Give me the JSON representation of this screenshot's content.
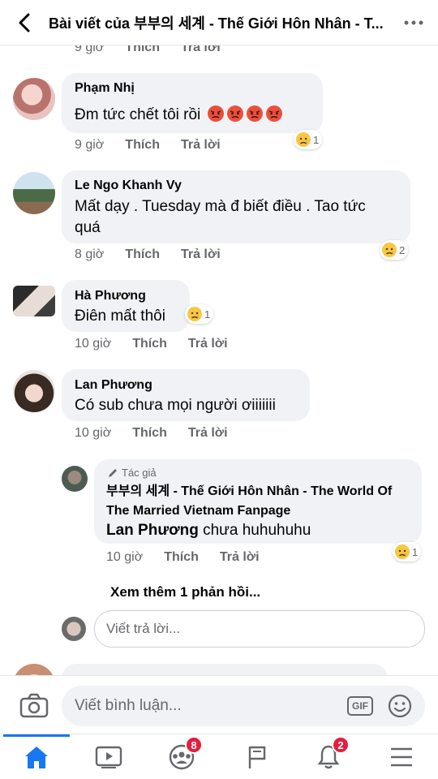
{
  "header": {
    "title": "Bài viết của 부부의 세계 - Thế Giới Hôn Nhân - T..."
  },
  "labels": {
    "like": "Thích",
    "reply": "Trả lời"
  },
  "comments": [
    {
      "name": "",
      "text": "",
      "time": "9 giờ",
      "like": "Thích",
      "reply": "Trả lời"
    },
    {
      "name": "Phạm Nhị",
      "text": "Đm tức chết tôi rồi",
      "emoji_count": 4,
      "time": "9 giờ",
      "reaction_count": "1"
    },
    {
      "name": "Le Ngo Khanh Vy",
      "text_line1": "Mất dạy . Tuesday mà đ biết điều . Tao tức",
      "text_line2": "quá",
      "time": "8 giờ",
      "reaction_count": "2"
    },
    {
      "name": "Hà Phương",
      "text": "Điên mất thôi",
      "time": "10 giờ",
      "reaction_count": "1"
    },
    {
      "name": "Lan Phương",
      "text": "Có sub chưa mọi người ơiiiiiii",
      "time": "10 giờ"
    }
  ],
  "reply": {
    "badge": "Tác giả",
    "author_line1": "부부의 세계 - Thế Giới Hôn Nhân - The World Of",
    "author_line2": "The Married Vietnam Fanpage",
    "mention": "Lan Phương",
    "text": " chưa huhuhuhu",
    "time": "10 giờ",
    "reaction_count": "1"
  },
  "see_more": "Xem thêm 1 phản hồi...",
  "reply_placeholder": "Viết trả lời...",
  "composer": {
    "placeholder": "Viết bình luận...",
    "gif": "GIF"
  },
  "tabs": {
    "groups_badge": "8",
    "notifications_badge": "2"
  },
  "colors": {
    "accent": "#1877f2",
    "badge": "#e41e3f",
    "bubble": "#f0f2f5"
  }
}
